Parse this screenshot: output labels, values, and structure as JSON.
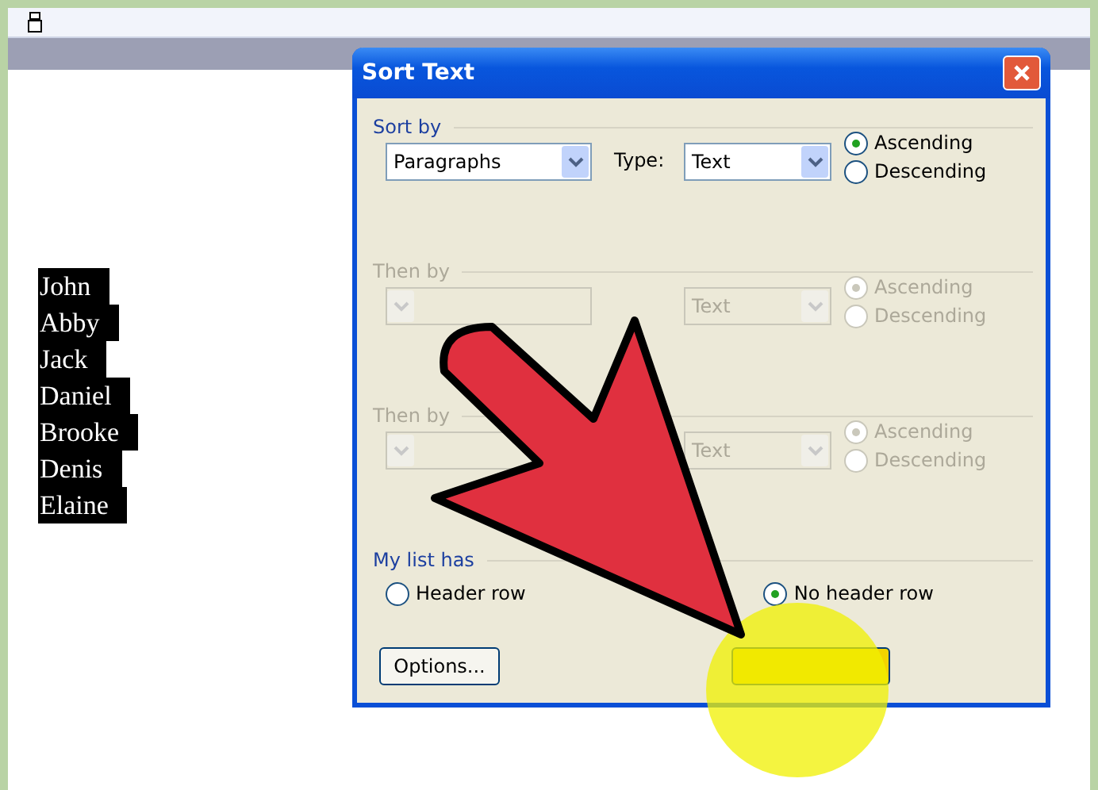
{
  "document": {
    "lines": [
      "John",
      "Abby",
      "Jack",
      "Daniel",
      "Brooke",
      "Denis",
      "Elaine"
    ]
  },
  "dialog": {
    "title": "Sort Text",
    "sections": [
      {
        "label": "Sort by",
        "disabled": false,
        "field": "Paragraphs",
        "type_label": "Type:",
        "type": "Text",
        "options": [
          {
            "label": "Ascending",
            "selected": true
          },
          {
            "label": "Descending",
            "selected": false
          }
        ]
      },
      {
        "label": "Then by",
        "disabled": true,
        "type": "Text",
        "options": [
          {
            "label": "Ascending",
            "selected": true
          },
          {
            "label": "Descending",
            "selected": false
          }
        ]
      },
      {
        "label": "Then by",
        "disabled": true,
        "type": "Text",
        "options": [
          {
            "label": "Ascending",
            "selected": true
          },
          {
            "label": "Descending",
            "selected": false
          }
        ]
      }
    ],
    "list_has": {
      "label": "My list has",
      "options": [
        {
          "label": "Header row",
          "selected": false
        },
        {
          "label": "No header row",
          "selected": true
        }
      ]
    },
    "options_button": "Options..."
  }
}
